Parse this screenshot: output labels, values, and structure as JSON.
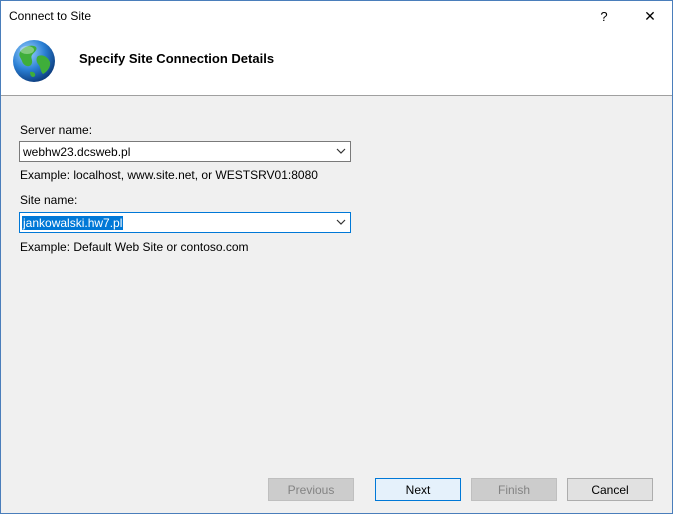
{
  "window": {
    "title": "Connect to Site",
    "help_label": "?",
    "close_label": "✕"
  },
  "header": {
    "title": "Specify Site Connection Details",
    "icon": "globe-icon"
  },
  "form": {
    "server_name_label": "Server name:",
    "server_name_value": "webhw23.dcsweb.pl",
    "server_name_example": "Example: localhost, www.site.net, or WESTSRV01:8080",
    "site_name_label": "Site name:",
    "site_name_value": "jankowalski.hw7.pl",
    "site_name_example": "Example: Default Web Site or contoso.com"
  },
  "buttons": {
    "previous": "Previous",
    "next": "Next",
    "finish": "Finish",
    "cancel": "Cancel"
  },
  "colors": {
    "accent": "#0078d7",
    "window_border": "#4a7ebb"
  }
}
